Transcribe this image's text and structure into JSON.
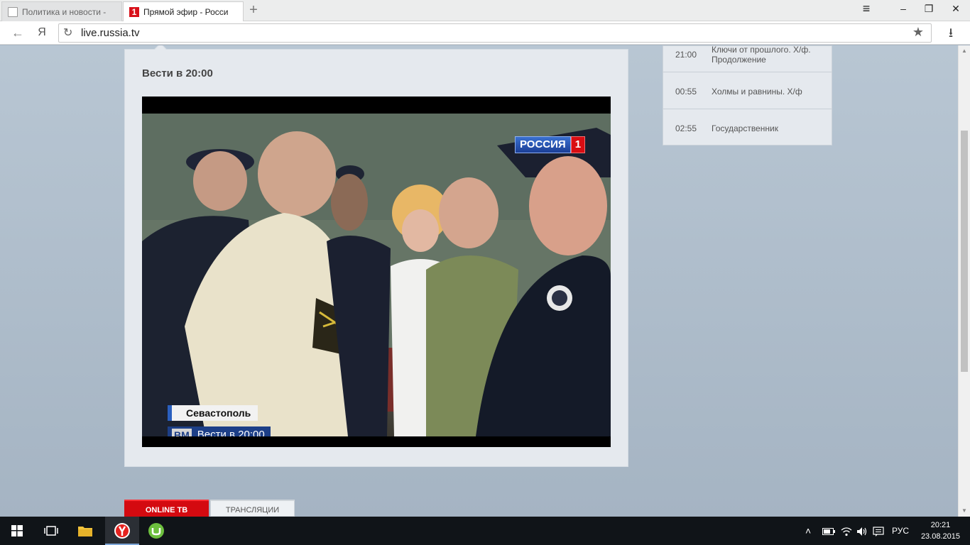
{
  "browser": {
    "tabs": [
      {
        "title": "Политика и новости -",
        "active": false
      },
      {
        "title": "Прямой эфир - Росси",
        "active": true,
        "favicon_text": "1"
      }
    ],
    "new_tab_glyph": "+",
    "window_controls": {
      "menu": "≡",
      "minimize": "–",
      "restore": "❐",
      "close": "✕"
    },
    "nav": {
      "back": "←",
      "yandex": "Я",
      "download": "⭳"
    },
    "url": "live.russia.tv"
  },
  "player": {
    "title": "Вести в 20:00",
    "channel_logo": {
      "word": "РОССИЯ",
      "num": "1"
    },
    "lower_third": {
      "city": "Севастополь",
      "show_mark": "ВМ",
      "show": "Вести в 20:00"
    }
  },
  "schedule": [
    {
      "time": "21:00",
      "name": "Ключи от прошлого. Х/ф. Продолжение"
    },
    {
      "time": "00:55",
      "name": "Холмы и равнины. Х/ф"
    },
    {
      "time": "02:55",
      "name": "Государственник"
    }
  ],
  "bottom_tabs": {
    "online": "ONLINE ТВ",
    "broadcasts": "ТРАНСЛЯЦИИ"
  },
  "taskbar": {
    "lang": "РУС",
    "time": "20:21",
    "date": "23.08.2015"
  }
}
